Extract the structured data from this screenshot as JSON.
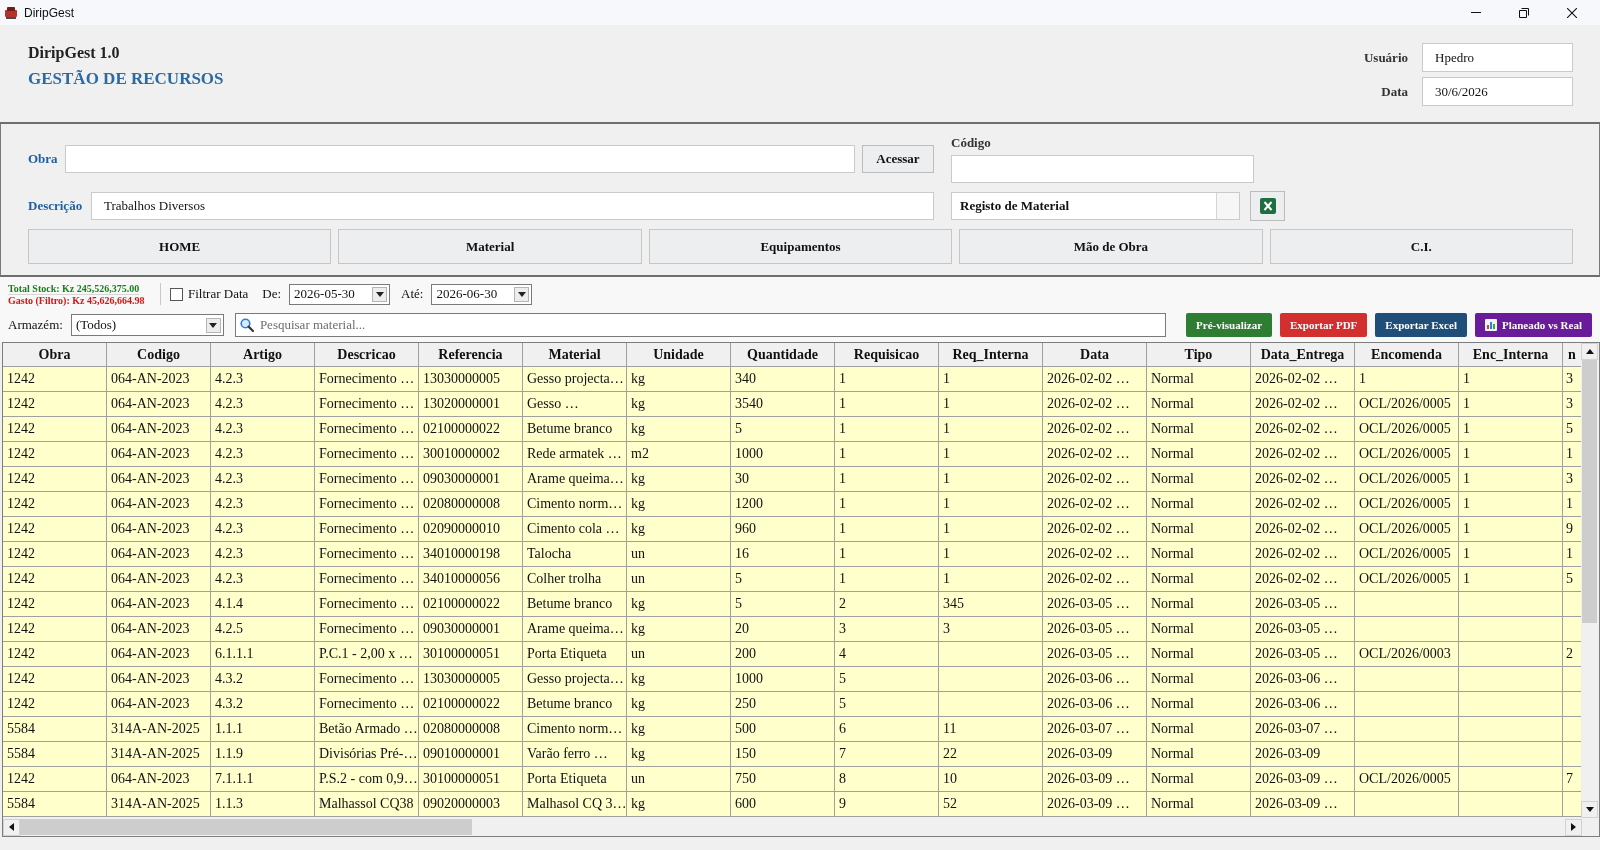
{
  "window": {
    "title": "DiripGest"
  },
  "header": {
    "app_name": "DiripGest 1.0",
    "subtitle": "GESTÃO DE RECURSOS",
    "user": {
      "label": "Usuário",
      "value": "Hpedro"
    },
    "date": {
      "label": "Data",
      "value": "30/6/2026"
    }
  },
  "form": {
    "obra": {
      "label": "Obra"
    },
    "access_button": "Acessar",
    "codigo": {
      "label": "Código"
    },
    "descricao": {
      "label": "Descrição",
      "value": "Trabalhos Diversos"
    },
    "report_type": {
      "value": "Registo de Material"
    },
    "nav_buttons": [
      "HOME",
      "Material",
      "Equipamentos",
      "Mão de Obra",
      "C.I."
    ]
  },
  "filters": {
    "total_stock": "Total Stock: Kz 245,526,375.00",
    "spent": "Gasto (Filtro): Kz 45,626,664.98",
    "date_filter": {
      "label": "Filtrar Data",
      "checked": false
    },
    "from": {
      "label": "De:",
      "value": "2026-05-30"
    },
    "to": {
      "label": "Até:",
      "value": "2026-06-30"
    },
    "warehouse": {
      "label": "Armazém:",
      "value": "(Todos)"
    },
    "search": {
      "placeholder": "Pesquisar material..."
    },
    "actions": [
      {
        "kind": "preview",
        "label": "Pré-visualizar",
        "color": "#2e7d32"
      },
      {
        "kind": "pdf",
        "label": "Exportar PDF",
        "color": "#d32f2f"
      },
      {
        "kind": "excel",
        "label": "Exportar Excel",
        "color": "#1f4e79"
      },
      {
        "kind": "chart",
        "label": "Planeado vs Real",
        "color": "#6a1b9a"
      }
    ]
  },
  "table": {
    "columns": [
      "Obra",
      "Codigo",
      "Artigo",
      "Descricao",
      "Referencia",
      "Material",
      "Unidade",
      "Quantidade",
      "Requisicao",
      "Req_Interna",
      "Data",
      "Tipo",
      "Data_Entrega",
      "Encomenda",
      "Enc_Interna",
      "n"
    ],
    "rows": [
      [
        "1242",
        "064-AN-2023",
        "4.2.3",
        "Fornecimento …",
        "13030000005",
        "Gesso projecta…",
        "kg",
        "340",
        "1",
        "1",
        "2026-02-02 …",
        "Normal",
        "2026-02-02 …",
        "1",
        "1",
        "3"
      ],
      [
        "1242",
        "064-AN-2023",
        "4.2.3",
        "Fornecimento …",
        "13020000001",
        "Gesso …",
        "kg",
        "3540",
        "1",
        "1",
        "2026-02-02 …",
        "Normal",
        "2026-02-02 …",
        "OCL/2026/0005",
        "1",
        "3"
      ],
      [
        "1242",
        "064-AN-2023",
        "4.2.3",
        "Fornecimento …",
        "02100000022",
        "Betume branco",
        "kg",
        "5",
        "1",
        "1",
        "2026-02-02 …",
        "Normal",
        "2026-02-02 …",
        "OCL/2026/0005",
        "1",
        "5"
      ],
      [
        "1242",
        "064-AN-2023",
        "4.2.3",
        "Fornecimento …",
        "30010000002",
        "Rede armatek …",
        "m2",
        "1000",
        "1",
        "1",
        "2026-02-02 …",
        "Normal",
        "2026-02-02 …",
        "OCL/2026/0005",
        "1",
        "1"
      ],
      [
        "1242",
        "064-AN-2023",
        "4.2.3",
        "Fornecimento …",
        "09030000001",
        "Arame queima…",
        "kg",
        "30",
        "1",
        "1",
        "2026-02-02 …",
        "Normal",
        "2026-02-02 …",
        "OCL/2026/0005",
        "1",
        "3"
      ],
      [
        "1242",
        "064-AN-2023",
        "4.2.3",
        "Fornecimento …",
        "02080000008",
        "Cimento norm…",
        "kg",
        "1200",
        "1",
        "1",
        "2026-02-02 …",
        "Normal",
        "2026-02-02 …",
        "OCL/2026/0005",
        "1",
        "1"
      ],
      [
        "1242",
        "064-AN-2023",
        "4.2.3",
        "Fornecimento …",
        "02090000010",
        "Cimento cola …",
        "kg",
        "960",
        "1",
        "1",
        "2026-02-02 …",
        "Normal",
        "2026-02-02 …",
        "OCL/2026/0005",
        "1",
        "9"
      ],
      [
        "1242",
        "064-AN-2023",
        "4.2.3",
        "Fornecimento …",
        "34010000198",
        "Talocha",
        "un",
        "16",
        "1",
        "1",
        "2026-02-02 …",
        "Normal",
        "2026-02-02 …",
        "OCL/2026/0005",
        "1",
        "1"
      ],
      [
        "1242",
        "064-AN-2023",
        "4.2.3",
        "Fornecimento …",
        "34010000056",
        "Colher trolha",
        "un",
        "5",
        "1",
        "1",
        "2026-02-02 …",
        "Normal",
        "2026-02-02 …",
        "OCL/2026/0005",
        "1",
        "5"
      ],
      [
        "1242",
        "064-AN-2023",
        "4.1.4",
        "Fornecimento …",
        "02100000022",
        "Betume branco",
        "kg",
        "5",
        "2",
        "345",
        "2026-03-05 …",
        "Normal",
        "2026-03-05 …"
      ],
      [
        "1242",
        "064-AN-2023",
        "4.2.5",
        "Fornecimento …",
        "09030000001",
        "Arame queima…",
        "kg",
        "20",
        "3",
        "3",
        "2026-03-05 …",
        "Normal",
        "2026-03-05 …"
      ],
      [
        "1242",
        "064-AN-2023",
        "6.1.1.1",
        "P.C.1 - 2,00 x …",
        "30100000051",
        "Porta Etiqueta",
        "un",
        "200",
        "4",
        null,
        "2026-03-05 …",
        "Normal",
        "2026-03-05 …",
        "OCL/2026/0003",
        null,
        "2"
      ],
      [
        "1242",
        "064-AN-2023",
        "4.3.2",
        "Fornecimento …",
        "13030000005",
        "Gesso projecta…",
        "kg",
        "1000",
        "5",
        null,
        "2026-03-06 …",
        "Normal",
        "2026-03-06 …"
      ],
      [
        "1242",
        "064-AN-2023",
        "4.3.2",
        "Fornecimento …",
        "02100000022",
        "Betume branco",
        "kg",
        "250",
        "5",
        null,
        "2026-03-06 …",
        "Normal",
        "2026-03-06 …"
      ],
      [
        "5584",
        "314A-AN-2025",
        "1.1.1",
        "Betão Armado …",
        "02080000008",
        "Cimento norm…",
        "kg",
        "500",
        "6",
        "11",
        "2026-03-07 …",
        "Normal",
        "2026-03-07 …"
      ],
      [
        "5584",
        "314A-AN-2025",
        "1.1.9",
        "Divisórias Pré-…",
        "09010000001",
        "Varão ferro …",
        "kg",
        "150",
        "7",
        "22",
        "2026-03-09",
        "Normal",
        "2026-03-09"
      ],
      [
        "1242",
        "064-AN-2023",
        "7.1.1.1",
        "P.S.2 - com 0,9…",
        "30100000051",
        "Porta Etiqueta",
        "un",
        "750",
        "8",
        "10",
        "2026-03-09 …",
        "Normal",
        "2026-03-09 …",
        "OCL/2026/0005",
        null,
        "7"
      ],
      [
        "5584",
        "314A-AN-2025",
        "1.1.3",
        "Malhassol CQ38",
        "09020000003",
        "Malhasol CQ 3…",
        "kg",
        "600",
        "9",
        "52",
        "2026-03-09 …",
        "Normal",
        "2026-03-09 …"
      ]
    ]
  }
}
